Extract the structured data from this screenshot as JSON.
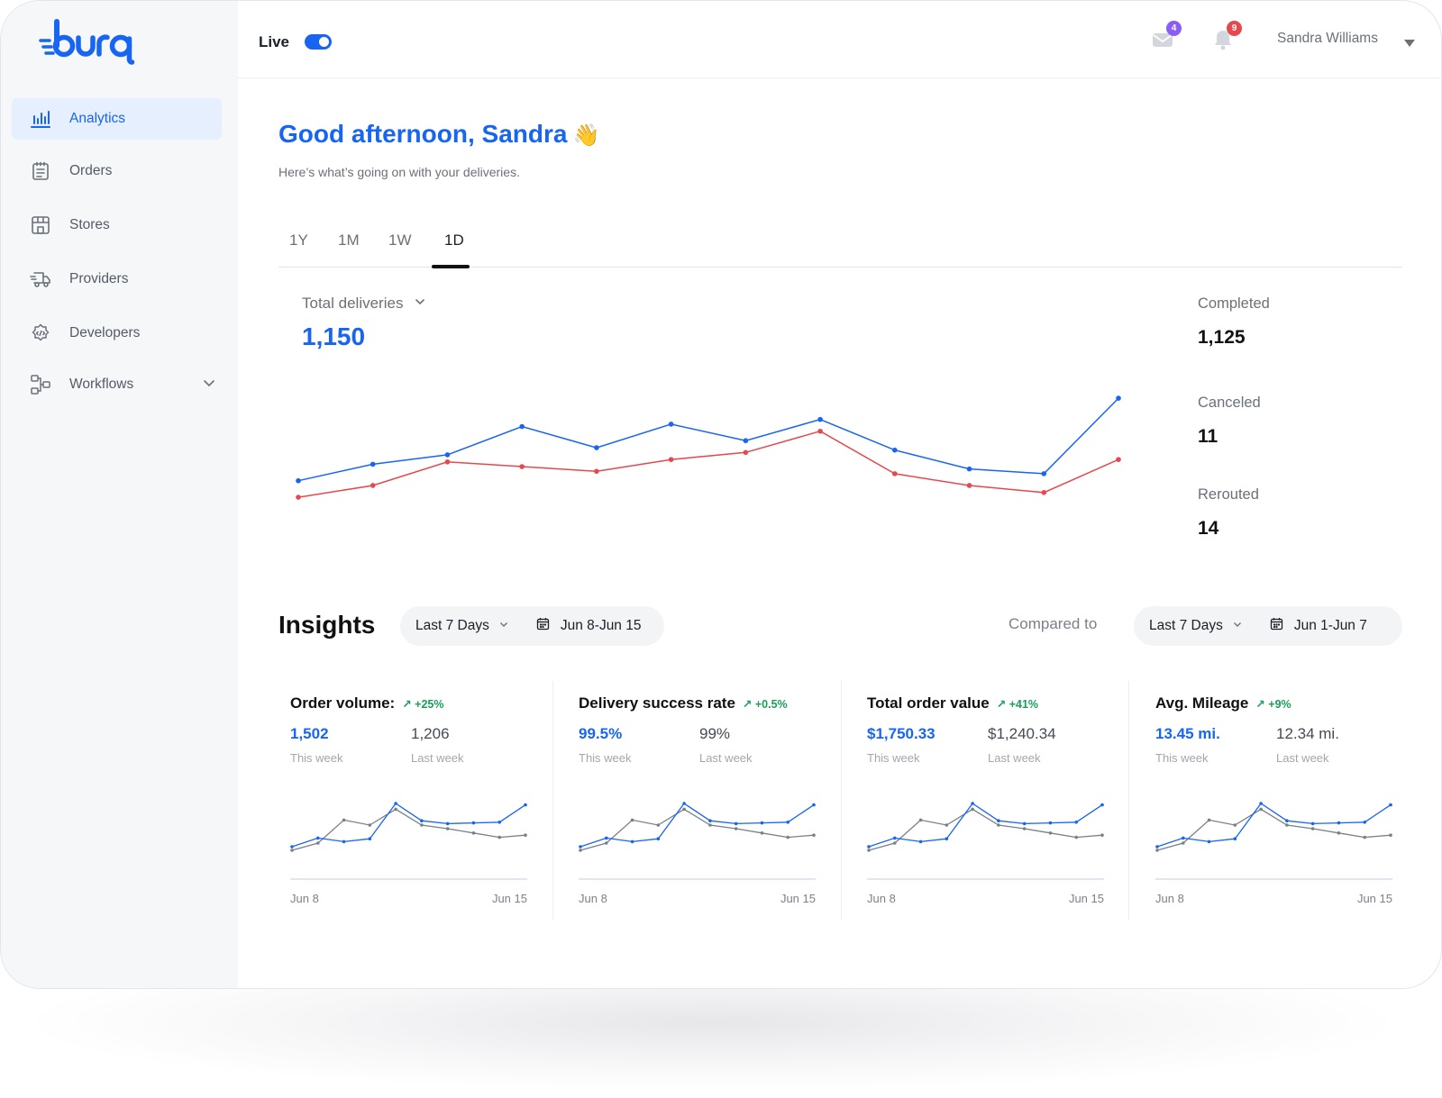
{
  "brand": {
    "logo_text": "burq",
    "accent": "#1765f0"
  },
  "sidebar": {
    "items": [
      {
        "label": "Analytics",
        "icon": "bar-chart-icon",
        "active": true
      },
      {
        "label": "Orders",
        "icon": "notepad-icon"
      },
      {
        "label": "Stores",
        "icon": "storefront-icon"
      },
      {
        "label": "Providers",
        "icon": "delivery-truck-icon"
      },
      {
        "label": "Developers",
        "icon": "code-gear-icon"
      },
      {
        "label": "Workflows",
        "icon": "workflow-icon",
        "has_submenu": true
      }
    ]
  },
  "topbar": {
    "live_label": "Live",
    "live_on": true,
    "messages_count": "4",
    "notifications_count": "9",
    "user_name": "Sandra Williams"
  },
  "header": {
    "greeting": "Good afternoon, Sandra",
    "greeting_emoji": "👋",
    "subtitle": "Here’s what’s going on with your deliveries."
  },
  "tabs": [
    "1Y",
    "1M",
    "1W",
    "1D"
  ],
  "active_tab": "1D",
  "summary": {
    "metric_label": "Total deliveries",
    "metric_value": "1,150",
    "stats": [
      {
        "label": "Completed",
        "value": "1,125"
      },
      {
        "label": "Canceled",
        "value": "11"
      },
      {
        "label": "Rerouted",
        "value": "14"
      }
    ]
  },
  "chart_data": {
    "type": "line",
    "x": [
      1,
      2,
      3,
      4,
      5,
      6,
      7,
      8,
      9,
      10,
      11,
      12
    ],
    "series": [
      {
        "color": "#1765f0",
        "values": [
          65,
          72,
          76,
          88,
          79,
          89,
          82,
          91,
          78,
          70,
          68,
          100
        ]
      },
      {
        "color": "#e5484d",
        "values": [
          58,
          63,
          73,
          71,
          69,
          74,
          77,
          86,
          68,
          63,
          60,
          74
        ]
      }
    ],
    "ylim": [
      50,
      105
    ]
  },
  "insights": {
    "title": "Insights",
    "range_label": "Last 7 Days",
    "range_dates": "Jun 8-Jun 15",
    "compared_label": "Compared to",
    "compare_range_label": "Last 7 Days",
    "compare_range_dates": "Jun 1-Jun 7",
    "x_start": "Jun 8",
    "x_end": "Jun 15",
    "this_week_label": "This week",
    "last_week_label": "Last week",
    "cards": [
      {
        "title": "Order volume:",
        "delta": "+25%",
        "this_week": "1,502",
        "last_week": "1,206"
      },
      {
        "title": "Delivery success rate",
        "delta": "+0.5%",
        "this_week": "99.5%",
        "last_week": "99%"
      },
      {
        "title": "Total order value",
        "delta": "+41%",
        "this_week": "$1,750.33",
        "last_week": "$1,240.34"
      },
      {
        "title": "Avg. Mileage",
        "delta": "+9%",
        "this_week": "13.45 mi.",
        "last_week": "12.34 mi."
      }
    ],
    "spark": {
      "this_week": [
        30,
        42,
        37,
        41,
        90,
        66,
        62,
        63,
        64,
        88
      ],
      "last_week": [
        25,
        35,
        67,
        60,
        82,
        60,
        55,
        49,
        43,
        46
      ],
      "this_color": "#1765f0",
      "last_color": "#7b7f87"
    }
  }
}
